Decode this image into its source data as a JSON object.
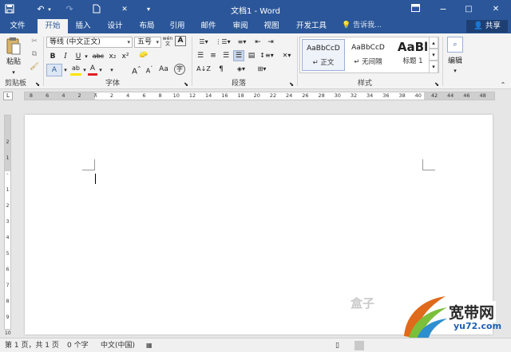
{
  "titlebar": {
    "title": "文档1 - Word"
  },
  "tabs": [
    {
      "label": "文件"
    },
    {
      "label": "开始"
    },
    {
      "label": "插入"
    },
    {
      "label": "设计"
    },
    {
      "label": "布局"
    },
    {
      "label": "引用"
    },
    {
      "label": "邮件"
    },
    {
      "label": "审阅"
    },
    {
      "label": "视图"
    },
    {
      "label": "开发工具"
    }
  ],
  "tell_me": "告诉我...",
  "share": "共享",
  "clipboard": {
    "paste": "粘贴",
    "group": "剪贴板"
  },
  "font": {
    "name": "等线 (中文正文)",
    "size": "五号",
    "group": "字体",
    "size_label": "wén",
    "bold": "B",
    "italic": "I",
    "underline": "U",
    "strike": "abc",
    "sub": "x₂",
    "sup": "x²",
    "grow": "A",
    "shrink": "A",
    "color_a": "A",
    "effect": "A"
  },
  "paragraph": {
    "group": "段落"
  },
  "styles": {
    "group": "样式",
    "items": [
      {
        "preview": "AaBbCcD",
        "name": "↵ 正文"
      },
      {
        "preview": "AaBbCcD",
        "name": "↵ 无间隔"
      },
      {
        "preview": "AaBl",
        "name": "标题 1"
      }
    ]
  },
  "editing": {
    "label": "编辑"
  },
  "ruler": {
    "ticks": [
      "8",
      "6",
      "4",
      "2",
      "",
      "2",
      "4",
      "6",
      "8",
      "10",
      "12",
      "14",
      "16",
      "18",
      "20",
      "22",
      "24",
      "26",
      "28",
      "30",
      "32",
      "34",
      "36",
      "38",
      "40",
      "42",
      "44",
      "46",
      "48"
    ]
  },
  "vruler": {
    "ticks": [
      "2",
      "1",
      "",
      "1",
      "2",
      "3",
      "4",
      "5",
      "6",
      "7",
      "8",
      "9",
      "10"
    ]
  },
  "status": {
    "page": "第 1 页，共 1 页",
    "words": "0 个字",
    "lang": "中文(中国)"
  },
  "watermark": {
    "text1": "宽带网",
    "text2": "yu72.com",
    "text3": "盒子"
  },
  "colors": {
    "accent": "#2b579a"
  }
}
